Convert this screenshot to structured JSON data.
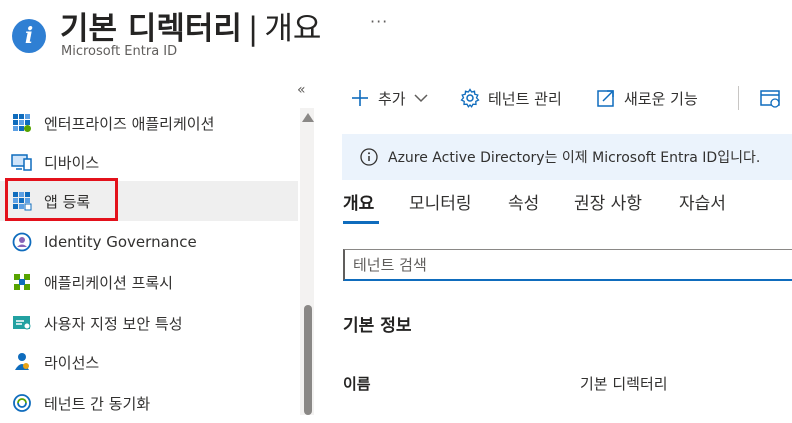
{
  "header": {
    "title": "기본 디렉터리",
    "separator": "|",
    "title_tail": "개요",
    "subtitle": "Microsoft Entra ID",
    "more": "···",
    "info_glyph": "i"
  },
  "sidebar": {
    "collapse": "«",
    "items": [
      {
        "label": "엔터프라이즈 애플리케이션",
        "icon": "enterprise-apps-icon"
      },
      {
        "label": "디바이스",
        "icon": "devices-icon"
      },
      {
        "label": "앱 등록",
        "icon": "app-registrations-icon",
        "selected": true
      },
      {
        "label": "Identity Governance",
        "icon": "identity-governance-icon"
      },
      {
        "label": "애플리케이션 프록시",
        "icon": "application-proxy-icon"
      },
      {
        "label": "사용자 지정 보안 특성",
        "icon": "custom-security-attributes-icon"
      },
      {
        "label": "라이선스",
        "icon": "licenses-icon"
      },
      {
        "label": "테넌트 간 동기화",
        "icon": "cross-tenant-sync-icon"
      }
    ]
  },
  "toolbar": {
    "add": "추가",
    "manage_tenants": "테넌트 관리",
    "whats_new": "새로운 기능"
  },
  "banner": {
    "text": "Azure Active Directory는 이제 Microsoft Entra ID입니다."
  },
  "tabs": [
    {
      "label": "개요",
      "active": true
    },
    {
      "label": "모니터링"
    },
    {
      "label": "속성"
    },
    {
      "label": "권장 사항"
    },
    {
      "label": "자습서"
    }
  ],
  "search": {
    "placeholder": "테넌트 검색"
  },
  "basic_info": {
    "heading": "기본 정보",
    "name_key": "이름",
    "name_value": "기본 디렉터리"
  },
  "colors": {
    "accent": "#0f6cbd",
    "highlight": "#e3111b",
    "banner_bg": "#ebf3fc"
  }
}
